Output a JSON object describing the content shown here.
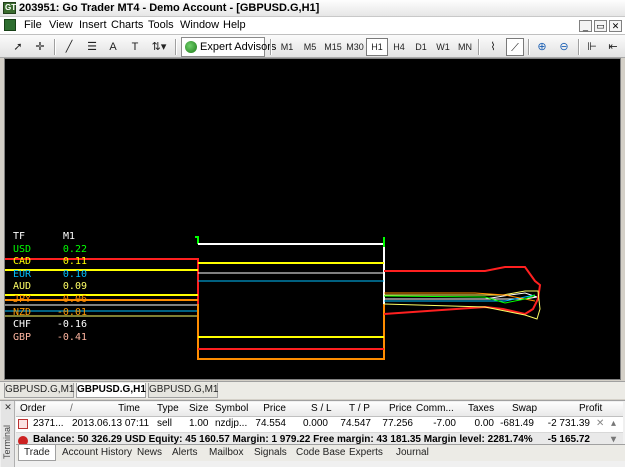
{
  "window": {
    "title": "203951: Go Trader MT4 - Demo Account - [GBPUSD.G,H1]"
  },
  "menu": {
    "items": [
      "File",
      "View",
      "Insert",
      "Charts",
      "Tools",
      "Window",
      "Help"
    ]
  },
  "toolbar": {
    "expert_advisors_label": "Expert Advisors",
    "timeframes": [
      "M1",
      "M5",
      "M15",
      "M30",
      "H1",
      "H4",
      "D1",
      "W1",
      "MN"
    ],
    "active_timeframe": "H1"
  },
  "chart_panel": {
    "header": {
      "tf": "TF",
      "value": "M1"
    },
    "currencies": [
      {
        "name": "USD",
        "value": "0.22",
        "color": "#00ff00"
      },
      {
        "name": "CAD",
        "value": "0.11",
        "color": "#ffff00"
      },
      {
        "name": "EUR",
        "value": "0.10",
        "color": "#00bfff"
      },
      {
        "name": "AUD",
        "value": "0.09",
        "color": "#ffff66"
      },
      {
        "name": "JPY",
        "value": "0.06",
        "color": "#ff8c00"
      },
      {
        "name": "NZD",
        "value": "-0.01",
        "color": "#ff9900"
      },
      {
        "name": "CHF",
        "value": "-0.16",
        "color": "#ffffff"
      },
      {
        "name": "GBP",
        "value": "-0.41",
        "color": "#ffb6a0"
      }
    ]
  },
  "chart_tabs": [
    "GBPUSD.G,M1",
    "GBPUSD.G,H1",
    "GBPUSD.G,M1"
  ],
  "active_chart_tab": "GBPUSD.G,H1",
  "terminal": {
    "side_label": "Terminal",
    "columns": [
      "Order",
      "/",
      "Time",
      "Type",
      "Size",
      "Symbol",
      "Price",
      "S / L",
      "T / P",
      "Price",
      "Comm...",
      "Taxes",
      "Swap",
      "Profit"
    ],
    "rows": [
      {
        "order": "2371...",
        "time": "2013.06.13 07:11",
        "type": "sell",
        "size": "1.00",
        "symbol": "nzdjp...",
        "price": "74.554",
        "sl": "0.000",
        "tp": "74.547",
        "cur_price": "77.256",
        "commission": "-7.00",
        "taxes": "0.00",
        "swap": "-681.49",
        "profit": "-2 731.39"
      }
    ],
    "balance_line": "Balance: 50 326.29 USD  Equity: 45 160.57  Margin: 1 979.22  Free margin: 43 181.35  Margin level: 2281.74%",
    "balance_profit": "-5 165.72"
  },
  "bottom_tabs": [
    "Trade",
    "Account History",
    "News",
    "Alerts",
    "Mailbox",
    "Signals",
    "Code Base",
    "Experts",
    "Journal"
  ],
  "active_bottom_tab": "Trade"
}
